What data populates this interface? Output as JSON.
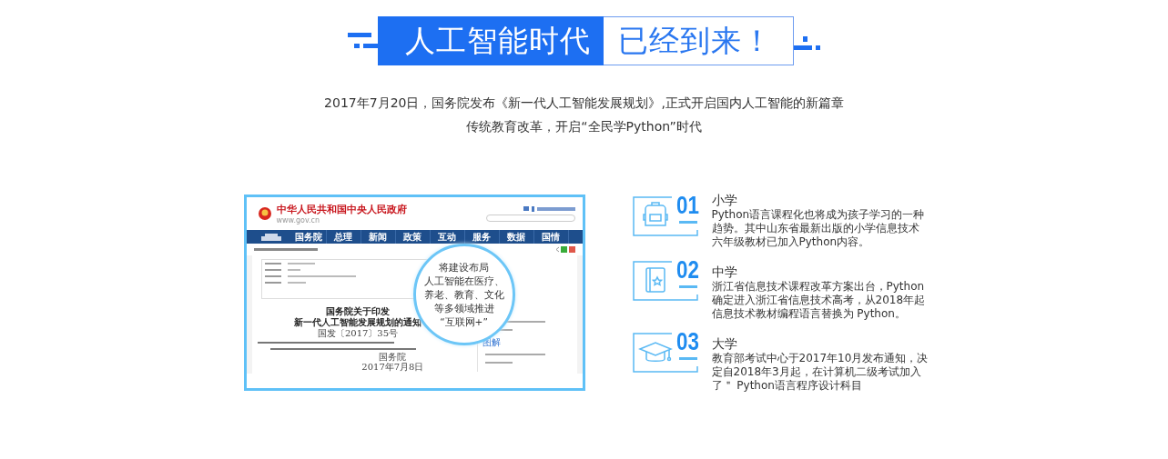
{
  "banner": {
    "highlight": "人工智能时代",
    "rest": "已经到来！"
  },
  "intro": [
    "2017年7月20日，国务院发布《新一代人工智能发展规划》,正式开启国内人工智能的新篇章",
    "传统教育改革，开启“全民学Python”时代"
  ],
  "screenshot": {
    "site_title": "中华人民共和国中央人民政府",
    "site_url": "www.gov.cn",
    "nav": [
      "国务院",
      "总理",
      "新闻",
      "政策",
      "互动",
      "服务",
      "数据",
      "国情"
    ],
    "popup": [
      "将建设布局",
      "人工智能在医疗、",
      "养老、教育、文化",
      "等多领域推进",
      "“互联网+”"
    ],
    "document": {
      "title": [
        "国务院关于印发",
        "新一代人工智能发展规划的通知"
      ],
      "number": "国发〔2017〕35号",
      "signature": "国务院",
      "date": "2017年7月8日"
    },
    "sidebar_heading": "图解"
  },
  "stages": [
    {
      "kind": "backpack",
      "number": "01",
      "title": "小学",
      "text": "Python语言课程化也将成为孩子学习的一种趋势。其中山东省最新出版的小学信息技术六年级教材已加入Python内容。"
    },
    {
      "kind": "book",
      "number": "02",
      "title": "中学",
      "text": "浙江省信息技术课程改革方案出台，Python确定进入浙江省信息技术高考，从2018年起信息技术教材编程语言替换为 Python。"
    },
    {
      "kind": "cap",
      "number": "03",
      "title": "大学",
      "text": "教育部考试中心于2017年10月发布通知，决定自2018年3月起，在计算机二级考试加入了＂ Python语言程序设计科目"
    }
  ]
}
